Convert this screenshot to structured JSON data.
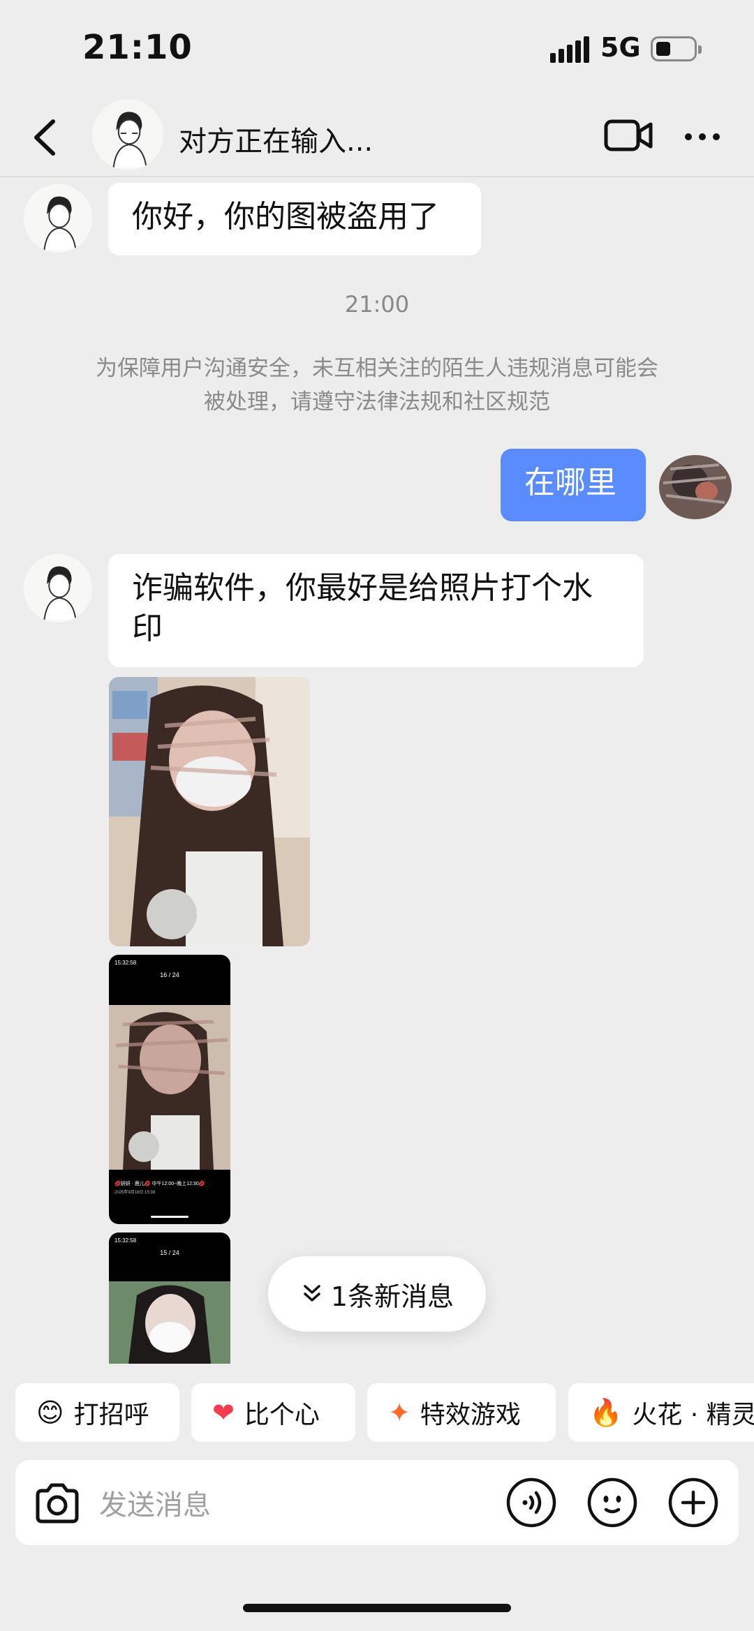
{
  "status": {
    "time": "21:10",
    "network": "5G"
  },
  "header": {
    "title": "对方正在输入..."
  },
  "messages": {
    "m1": "你好，你的图被盗用了",
    "time": "21:00",
    "notice": "为保障用户沟通安全，未互相关注的陌生人违规消息可能会被处理，请遵守法律法规和社区规范",
    "m2": "在哪里",
    "m3": "诈骗软件，你最好是给照片打个水印"
  },
  "screenshots": {
    "s1_top": "16 / 24",
    "s1_time": "15:32:58",
    "s1_caption_1": "💋妍妍 · 鹿儿💋 中午12:00~晚上12:30💋",
    "s1_caption_2": "2025年9月18日 15:38",
    "s2_top": "15 / 24",
    "s2_time": "15:32:58"
  },
  "new_message": "1条新消息",
  "chips": [
    {
      "icon": "hi-emoji-icon",
      "label": "打招呼"
    },
    {
      "icon": "heart-icon",
      "label": "比个心"
    },
    {
      "icon": "sparkle-icon",
      "label": "特效游戏"
    },
    {
      "icon": "fire-spirit-icon",
      "label": "火花 · 精灵"
    }
  ],
  "input": {
    "placeholder": "发送消息"
  },
  "colors": {
    "accent": "#5b8cff",
    "background": "#ededed",
    "bubble": "#ffffff"
  }
}
